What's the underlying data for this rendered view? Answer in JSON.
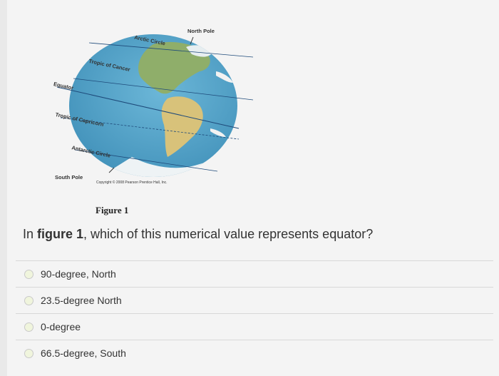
{
  "figure": {
    "labels": {
      "north_pole": "North Pole",
      "arctic_circle": "Arctic Circle",
      "tropic_cancer": "Tropic of Cancer",
      "equator": "Equator",
      "tropic_capricorn": "Tropic of Capricorn",
      "antarctic_circle": "Antarctic Circle",
      "south_pole": "South Pole",
      "copyright": "Copyright © 2008 Pearson Prentice Hall, Inc."
    },
    "caption": "Figure 1"
  },
  "question": {
    "prefix": "In ",
    "bold": "figure 1",
    "suffix": ", which of this numerical value represents equator?"
  },
  "options": [
    {
      "label": "90-degree, North"
    },
    {
      "label": "23.5-degree North"
    },
    {
      "label": "0-degree"
    },
    {
      "label": "66.5-degree, South"
    }
  ],
  "colors": {
    "ocean": "#5aa6c9",
    "land": "#d8c27a",
    "green_land": "#8fae6a"
  }
}
